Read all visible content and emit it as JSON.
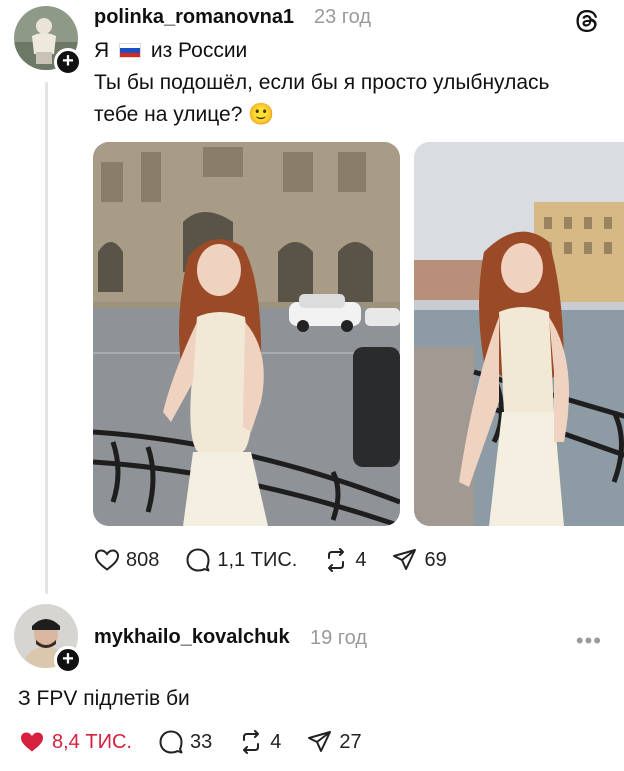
{
  "post": {
    "username": "polinka_romanovna1",
    "time": "23 год",
    "line1_prefix": "Я",
    "line1_suffix": "из России",
    "line2": "Ты бы подошёл, если бы я просто улыбнулась",
    "line3": "тебе на улице? 🙂",
    "stats": {
      "likes": "808",
      "comments": "1,1 ТИС.",
      "reposts": "4",
      "shares": "69"
    },
    "icons": [
      "heart-icon",
      "comment-icon",
      "repost-icon",
      "share-icon",
      "threads-logo-icon",
      "russia-flag-icon",
      "add-plus-icon"
    ]
  },
  "reply": {
    "username": "mykhailo_kovalchuk",
    "time": "19 год",
    "text": "З FPV підлетів би",
    "more": "•••",
    "stats": {
      "likes": "8,4 ТИС.",
      "comments": "33",
      "reposts": "4",
      "shares": "27"
    }
  },
  "colors": {
    "text": "#111111",
    "muted": "#9a9a9a",
    "like_active": "#d5213f",
    "thread_line": "#e3e3e3"
  }
}
